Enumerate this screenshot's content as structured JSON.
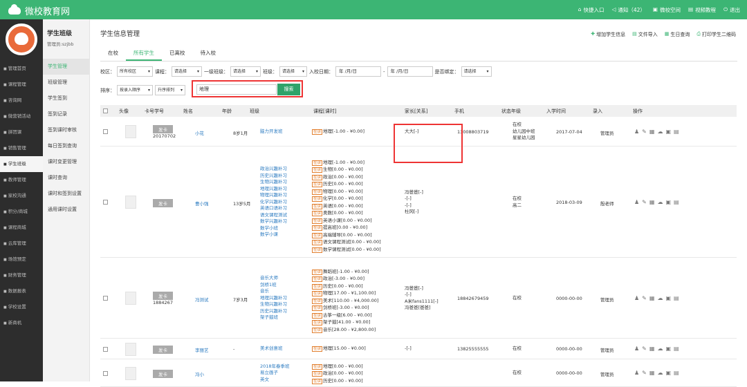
{
  "header": {
    "logo": "微校教育网",
    "nav": [
      {
        "icon": "key-icon",
        "label": "快捷入口"
      },
      {
        "icon": "share-icon",
        "label": "通知（42）"
      },
      {
        "icon": "book-icon",
        "label": "微校空间"
      },
      {
        "icon": "monitor-icon",
        "label": "视频教程"
      },
      {
        "icon": "power-icon",
        "label": "退出"
      }
    ]
  },
  "sidebar": [
    {
      "icon": "home-icon",
      "label": "管理首页"
    },
    {
      "icon": "course-icon",
      "label": "课程管理"
    },
    {
      "icon": "consult-icon",
      "label": "咨询网"
    },
    {
      "icon": "marketing-icon",
      "label": "微营销活动"
    },
    {
      "icon": "group-icon",
      "label": "拼团课"
    },
    {
      "icon": "sales-icon",
      "label": "销售管理"
    },
    {
      "icon": "class-icon",
      "label": "学生班级"
    },
    {
      "icon": "teacher-icon",
      "label": "教师管理"
    },
    {
      "icon": "home-school-icon",
      "label": "家校沟通"
    },
    {
      "icon": "points-icon",
      "label": "积分/商城"
    },
    {
      "icon": "mall-icon",
      "label": "课程商城"
    },
    {
      "icon": "cloud-icon",
      "label": "云库管理"
    },
    {
      "icon": "venue-icon",
      "label": "场馆预定"
    },
    {
      "icon": "finance-icon",
      "label": "财务管理"
    },
    {
      "icon": "report-icon",
      "label": "数据报表"
    },
    {
      "icon": "settings-icon",
      "label": "学校设置"
    },
    {
      "icon": "new-icon",
      "label": "新商机"
    }
  ],
  "submenu": {
    "title": "学生班级",
    "user": "管理员:szjbb",
    "items": [
      "学生管理",
      "班级管理",
      "学生签到",
      "签到记录",
      "签到课时审核",
      "每日签到查询",
      "课时变更管理",
      "课时查询",
      "课时和签到设置",
      "通用课时设置"
    ]
  },
  "page": {
    "title": "学生信息管理",
    "actions": [
      "增加学生信息",
      "文件导入",
      "生日查询",
      "打印学生二维码"
    ],
    "tabs": [
      "在校",
      "所有学生",
      "已离校",
      "待入校"
    ]
  },
  "filters": {
    "campus_label": "校区：",
    "campus": "所有校区",
    "course_label": "课程：",
    "course": "请选择",
    "class1_label": "一级班级：",
    "class1": "请选择",
    "class_label": "班级：",
    "class": "请选择",
    "date_label": "入校日期：",
    "date_from": "年 /月/日",
    "dash": "-",
    "date_to": "年 /月/日",
    "bind_label": "是否绑定：",
    "bind": "请选择",
    "sort_label": "排序：",
    "sort": "按录入顺序",
    "order": "升序排列",
    "search_value": "地理",
    "search_btn": "搜索"
  },
  "table": {
    "headers": [
      "头像",
      "卡号学号",
      "姓名",
      "年龄",
      "班级",
      "课程[课时]",
      "家长[关系]",
      "手机",
      "状态年级",
      "入学时间",
      "录入",
      "操作"
    ],
    "rows": [
      {
        "card": "发卡",
        "no": "20170702",
        "name": "小花",
        "age": "8岁1月",
        "classes": [
          "脑力开发班"
        ],
        "courses": [
          "地理[-1.00 - ¥0.00]"
        ],
        "parents": [
          "大大[-]"
        ],
        "phone": "13008803719",
        "status": [
          "在校",
          "幼儿园中班",
          "星星幼儿园"
        ],
        "date": "2017-07-04",
        "by": "管理员"
      },
      {
        "card": "发卡",
        "no": "",
        "name": "曹小强",
        "age": "13岁5月",
        "classes": [
          "政治兴趣补习",
          "历史兴趣补习",
          "生物兴趣补习",
          "地理兴趣补习",
          "物理兴趣补习",
          "化学兴趣补习",
          "英语口语补习",
          "语文课程测试",
          "数学兴趣补习",
          "数学小班",
          "数学小课"
        ],
        "courses": [
          "地理[-1.00 - ¥0.00]",
          "生物[0.00 - ¥0.00]",
          "政治[0.00 - ¥0.00]",
          "历史[0.00 - ¥0.00]",
          "物理[0.00 - ¥0.00]",
          "化学[0.00 - ¥0.00]",
          "英语[0.00 - ¥0.00]",
          "奥数[0.00 - ¥0.00]",
          "英语小课[0.00 - ¥0.00]",
          "提高班[0.00 - ¥0.00]",
          "高端辅导[0.00 - ¥0.00]",
          "语文课程测试[0.00 - ¥0.00]",
          "数学课程测试[0.00 - ¥0.00]"
        ],
        "parents": [
          "冯爸爸[-]",
          "-[-]",
          "-[-]",
          "杜冈[-]"
        ],
        "phone": "",
        "status": [
          "在校",
          "高二"
        ],
        "date": "2018-03-09",
        "by": "殷老师"
      },
      {
        "card": "发卡",
        "no": "1884267",
        "name": "冯测试",
        "age": "7岁3月",
        "classes": [
          "音乐大师",
          "剑桥1班",
          "音乐",
          "地理兴趣补习",
          "生物兴趣补习",
          "历史兴趣补习",
          "架子鼓班"
        ],
        "courses": [
          "舞蹈班[-1.00 - ¥0.00]",
          "政治[-3.00 - ¥0.00]",
          "历史[0.00 - ¥0.00]",
          "物理[17.00 - ¥1,100.00]",
          "美术[110.00 - ¥4,000.00]",
          "剑桥班[-3.00 - ¥0.00]",
          "古筝一级[6.00 - ¥0.00]",
          "架子鼓[41.00 - ¥0.00]",
          "音乐[28.00 - ¥2,800.00]"
        ],
        "parents": [
          "冯爸爸[-]",
          "-[-]",
          "A米fans1111[-]",
          "冯爸爸[爸爸]"
        ],
        "phone": "18842679459",
        "status": [
          "在校"
        ],
        "date": "0000-00-00",
        "by": "管理员"
      },
      {
        "card": "发卡",
        "no": "",
        "name": "李丽艺",
        "age": "-",
        "classes": [
          "美术创意班"
        ],
        "courses": [
          "地理[15.00 - ¥0.00]"
        ],
        "parents": [
          "-[-]"
        ],
        "phone": "13825555555",
        "status": [
          "在校"
        ],
        "date": "0000-00-00",
        "by": "管理员"
      },
      {
        "card": "发卡",
        "no": "",
        "name": "冯小",
        "age": "",
        "classes": [
          "2018年春季班",
          "易立画子",
          "英文"
        ],
        "courses": [
          "地理[0.00 - ¥0.00]",
          "政治[0.00 - ¥0.00]",
          "历史[0.00 - ¥0.00]"
        ],
        "parents": [],
        "phone": "",
        "status": [
          "在校"
        ],
        "date": "0000-00-00",
        "by": "管理员"
      }
    ]
  },
  "tag_label": "在读",
  "colors": {
    "brand": "#3cb574",
    "highlight": "#e33",
    "link": "#2a7ac0",
    "tag": "#e27f2e"
  }
}
